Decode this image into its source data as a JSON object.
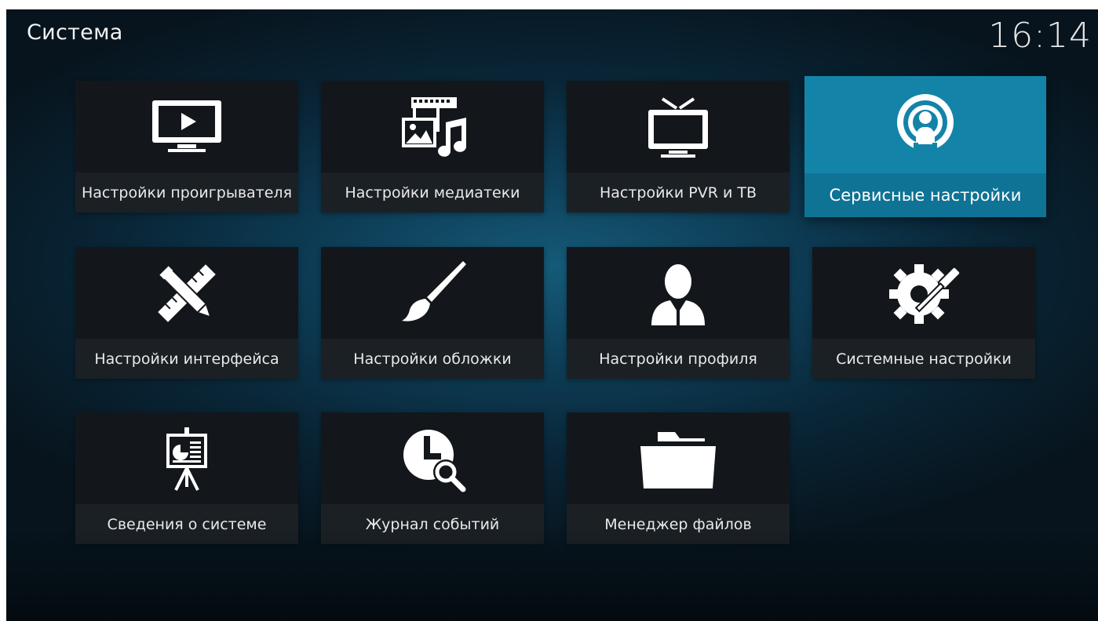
{
  "header": {
    "title": "Система",
    "clock": "16:14"
  },
  "tiles": [
    {
      "label": "Настройки проигрывателя",
      "icon": "tv-play-icon"
    },
    {
      "label": "Настройки медиатеки",
      "icon": "media-library-icon"
    },
    {
      "label": "Настройки PVR и ТВ",
      "icon": "tv-antenna-icon"
    },
    {
      "label": "Сервисные настройки",
      "icon": "broadcast-service-icon",
      "focused": true
    },
    {
      "label": "Настройки интерфейса",
      "icon": "pencil-ruler-icon"
    },
    {
      "label": "Настройки обложки",
      "icon": "paintbrush-icon"
    },
    {
      "label": "Настройки профиля",
      "icon": "user-profile-icon"
    },
    {
      "label": "Системные настройки",
      "icon": "gear-screwdriver-icon"
    },
    {
      "label": "Сведения о системе",
      "icon": "presentation-board-icon"
    },
    {
      "label": "Журнал событий",
      "icon": "clock-search-icon"
    },
    {
      "label": "Менеджер файлов",
      "icon": "folder-icon"
    }
  ],
  "colors": {
    "accent": "#1384a8",
    "tile": "#13171b",
    "tile_label_bar": "#1b2025"
  }
}
